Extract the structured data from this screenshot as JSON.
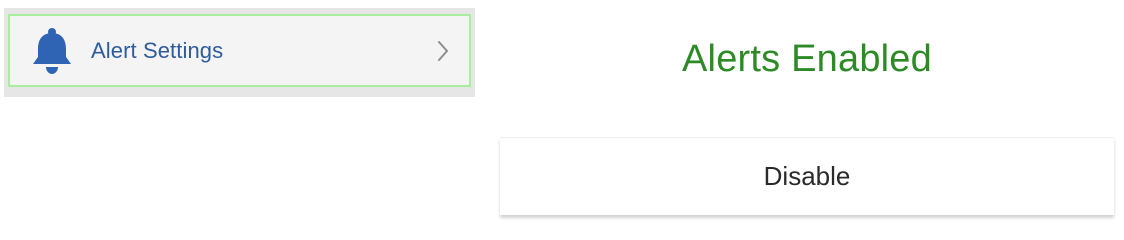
{
  "settings_menu": {
    "icon": "bell-icon",
    "label": "Alert Settings",
    "chevron_icon": "chevron-right-icon",
    "highlight_color": "#a7ef9f",
    "label_color": "#2f5b9b"
  },
  "alerts_panel": {
    "status_text": "Alerts Enabled",
    "status_color": "#2e8a26",
    "disable_button_label": "Disable"
  }
}
